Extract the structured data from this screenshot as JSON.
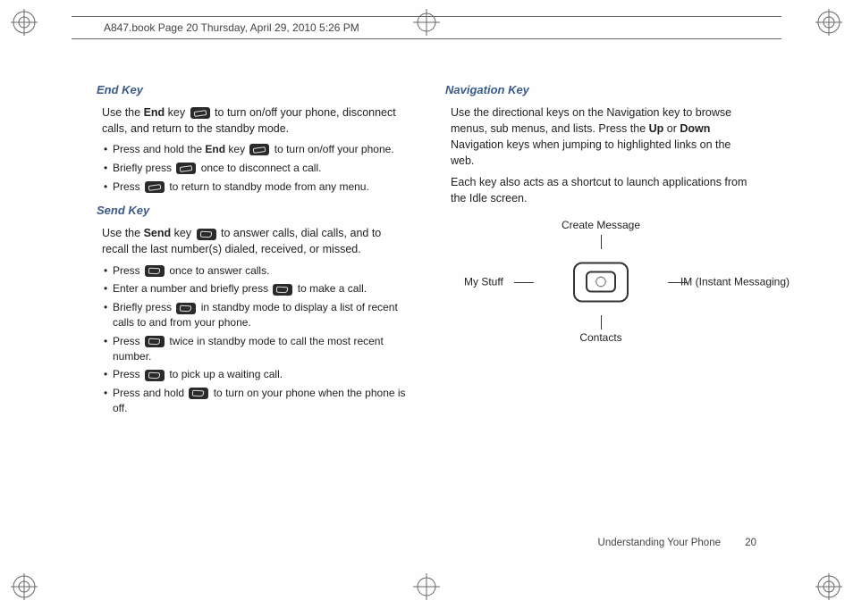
{
  "header": {
    "text": "A847.book  Page 20  Thursday, April 29, 2010  5:26 PM"
  },
  "left": {
    "endKey": {
      "heading": "End Key",
      "intro_pre": "Use the ",
      "intro_bold": "End",
      "intro_mid": " key ",
      "intro_post": " to turn on/off your phone, disconnect calls, and return to the standby mode.",
      "bullets": {
        "b1_pre": "Press and hold the ",
        "b1_bold": "End",
        "b1_mid": " key ",
        "b1_post": " to turn on/off your phone.",
        "b2_pre": "Briefly press ",
        "b2_post": " once to disconnect a call.",
        "b3_pre": "Press ",
        "b3_post": " to return to standby mode from any menu."
      }
    },
    "sendKey": {
      "heading": "Send Key",
      "intro_pre": "Use the ",
      "intro_bold": "Send",
      "intro_mid": " key ",
      "intro_post": " to answer calls, dial calls, and to recall the last number(s) dialed, received, or missed.",
      "bullets": {
        "b1_pre": "Press ",
        "b1_post": " once to answer calls.",
        "b2_pre": "Enter a number and briefly press ",
        "b2_post": " to make a call.",
        "b3_pre": "Briefly press ",
        "b3_post": " in standby mode to display a list of recent calls to and from your phone.",
        "b4_pre": "Press ",
        "b4_post": " twice in standby mode to call the most recent number.",
        "b5_pre": "Press ",
        "b5_post": " to pick up a waiting call.",
        "b6_pre": "Press and hold ",
        "b6_post": " to turn on your phone when the phone is off."
      }
    }
  },
  "right": {
    "navKey": {
      "heading": "Navigation Key",
      "p1_pre": "Use the directional keys on the Navigation key to browse menus, sub menus, and lists. Press the ",
      "p1_b1": "Up",
      "p1_mid": " or ",
      "p1_b2": "Down",
      "p1_post": " Navigation keys when jumping to highlighted links on the web.",
      "p2": "Each key also acts as a shortcut to launch applications from the Idle screen.",
      "labels": {
        "top": "Create Message",
        "left": "My Stuff",
        "right": "IM (Instant Messaging)",
        "bottom": "Contacts"
      }
    }
  },
  "footer": {
    "section": "Understanding Your Phone",
    "page": "20"
  }
}
